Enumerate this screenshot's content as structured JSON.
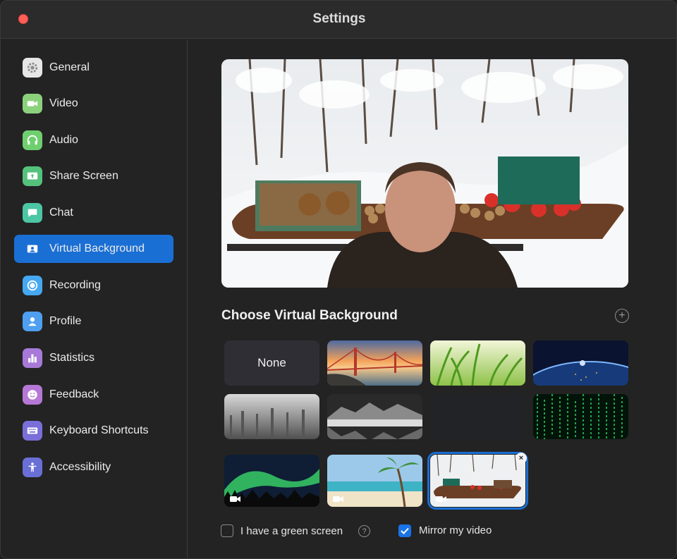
{
  "window": {
    "title": "Settings"
  },
  "sidebar": {
    "items": [
      {
        "label": "General",
        "icon": "gear-icon",
        "color": "#e8e8e8"
      },
      {
        "label": "Video",
        "icon": "video-camera-icon",
        "color": "#8bd17c"
      },
      {
        "label": "Audio",
        "icon": "headphones-icon",
        "color": "#6fcf6f"
      },
      {
        "label": "Share Screen",
        "icon": "share-screen-icon",
        "color": "#55c27c"
      },
      {
        "label": "Chat",
        "icon": "chat-bubble-icon",
        "color": "#4cc6a4"
      },
      {
        "label": "Virtual Background",
        "icon": "portrait-icon",
        "color": "#1a6fd4",
        "active": true
      },
      {
        "label": "Recording",
        "icon": "record-icon",
        "color": "#45a8f0"
      },
      {
        "label": "Profile",
        "icon": "person-icon",
        "color": "#4f9ff0"
      },
      {
        "label": "Statistics",
        "icon": "bar-chart-icon",
        "color": "#a779d8"
      },
      {
        "label": "Feedback",
        "icon": "smiley-icon",
        "color": "#b678d6"
      },
      {
        "label": "Keyboard Shortcuts",
        "icon": "keyboard-icon",
        "color": "#7a6fd8"
      },
      {
        "label": "Accessibility",
        "icon": "accessibility-icon",
        "color": "#6a6fd6"
      }
    ]
  },
  "main": {
    "section_title": "Choose Virtual Background",
    "add_icon": "plus-icon",
    "backgrounds": [
      {
        "label": "None",
        "type": "none"
      },
      {
        "type": "golden-gate"
      },
      {
        "type": "grass"
      },
      {
        "type": "earth-space"
      },
      {
        "type": "misty-forest"
      },
      {
        "type": "mountain-lake"
      },
      {
        "type": "dark-texture"
      },
      {
        "type": "green-matrix"
      },
      {
        "type": "aurora",
        "video": true
      },
      {
        "type": "beach",
        "video": true
      },
      {
        "type": "snow-boat",
        "video": true,
        "selected": true
      }
    ],
    "green_screen": {
      "label": "I have a green screen",
      "checked": false,
      "help_icon": "question-icon"
    },
    "mirror": {
      "label": "Mirror my video",
      "checked": true
    },
    "colors": {
      "accent": "#1a6fd4",
      "checkbox": "#1a73e8"
    }
  }
}
